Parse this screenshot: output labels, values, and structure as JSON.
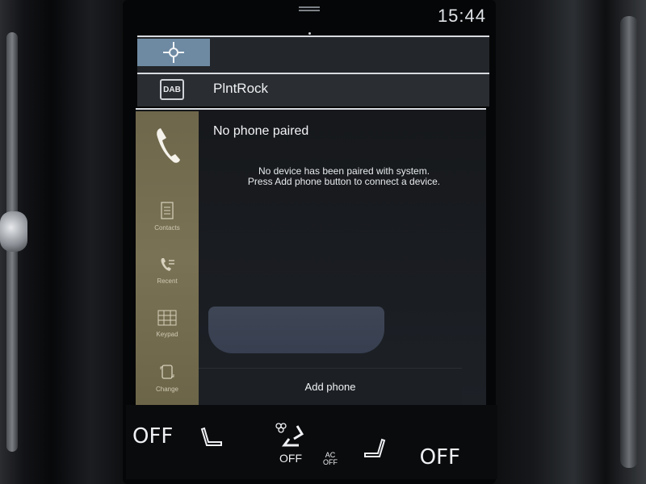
{
  "status_bar": {
    "time": "15:44"
  },
  "navigation_tile": {
    "icon": "map-compass-icon"
  },
  "radio_tile": {
    "source_icon_text": "DAB",
    "station": "PlntRock"
  },
  "phone": {
    "title": "No phone paired",
    "message_line1": "No device has been paired with system.",
    "message_line2": "Press Add phone button to connect a device.",
    "add_button": "Add phone",
    "side_buttons": [
      {
        "label": "Contacts",
        "icon": "contacts-icon"
      },
      {
        "label": "Recent",
        "icon": "recent-calls-icon"
      },
      {
        "label": "Keypad",
        "icon": "keypad-icon"
      },
      {
        "label": "Change",
        "icon": "change-phone-icon"
      }
    ]
  },
  "climate": {
    "left_temp": "OFF",
    "right_temp": "OFF",
    "fan": "OFF",
    "ac_line1": "AC",
    "ac_line2": "OFF"
  },
  "colors": {
    "nav_tile_accent": "#6e8aa3",
    "phone_sidebar": "#7a7254",
    "background": "#0b0c0e"
  }
}
